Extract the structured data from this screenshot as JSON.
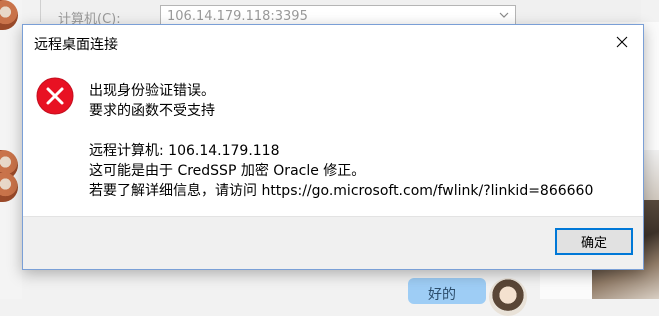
{
  "background": {
    "computer_label": "计算机(C):",
    "computer_value": "106.14.179.118:3395",
    "chat_text": "好的"
  },
  "dialog": {
    "title": "远程桌面连接",
    "close_icon": "close-icon",
    "error_icon": "error-icon",
    "error_color": "#e81123",
    "message_lines_1": [
      "出现身份验证错误。",
      "要求的函数不受支持"
    ],
    "message_lines_2": [
      "远程计算机: 106.14.179.118",
      "这可能是由于 CredSSP 加密 Oracle 修正。",
      "若要了解详细信息，请访问 https://go.microsoft.com/fwlink/?linkid=866660"
    ],
    "ok_label": "确定",
    "accent_color": "#0078d7"
  }
}
